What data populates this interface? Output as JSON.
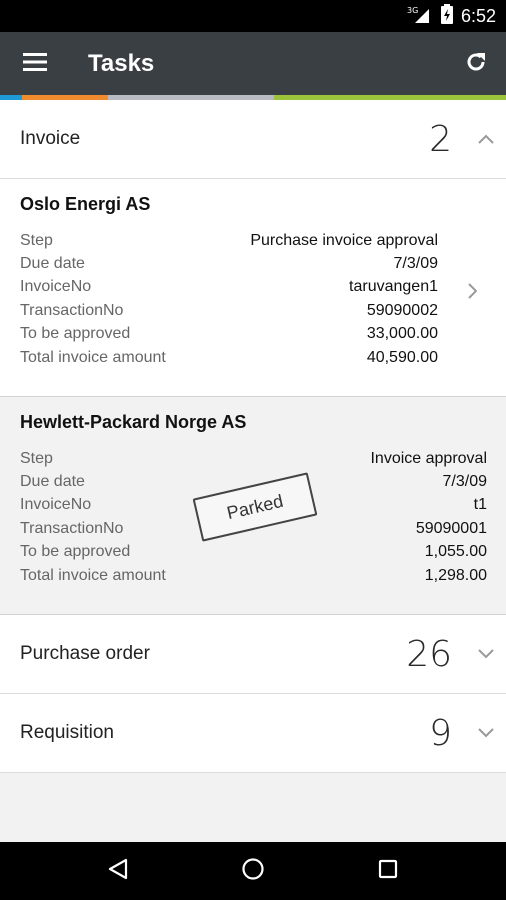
{
  "status_bar": {
    "network": "3G",
    "time": "6:52"
  },
  "app_bar": {
    "title": "Tasks",
    "menu_icon": "hamburger-menu-icon",
    "refresh_icon": "refresh-icon"
  },
  "colors": {
    "app_bar": "#3a3f44",
    "accent_blue": "#1e9ad6",
    "accent_orange": "#f08c2d",
    "accent_gray": "#b8bcc2",
    "accent_green": "#9cc43a"
  },
  "sections": {
    "invoice": {
      "label": "Invoice",
      "count": "2",
      "expanded": true,
      "tasks": [
        {
          "company": "Oslo Energi AS",
          "rows": [
            {
              "key": "Step",
              "value": "Purchase invoice approval"
            },
            {
              "key": "Due date",
              "value": "7/3/09"
            },
            {
              "key": "InvoiceNo",
              "value": "taruvangen1"
            },
            {
              "key": "TransactionNo",
              "value": "59090002"
            },
            {
              "key": "To be approved",
              "value": "33,000.00"
            },
            {
              "key": "Total invoice amount",
              "value": "40,590.00"
            }
          ]
        },
        {
          "company": "Hewlett-Packard Norge AS",
          "stamp": "Parked",
          "rows": [
            {
              "key": "Step",
              "value": "Invoice approval"
            },
            {
              "key": "Due date",
              "value": "7/3/09"
            },
            {
              "key": "InvoiceNo",
              "value": "t1"
            },
            {
              "key": "TransactionNo",
              "value": "59090001"
            },
            {
              "key": "To be approved",
              "value": "1,055.00"
            },
            {
              "key": "Total invoice amount",
              "value": "1,298.00"
            }
          ]
        }
      ]
    },
    "purchase_order": {
      "label": "Purchase order",
      "count": "26",
      "expanded": false
    },
    "requisition": {
      "label": "Requisition",
      "count": "9",
      "expanded": false
    }
  },
  "nav_bar": {
    "back_icon": "back-icon",
    "home_icon": "home-icon",
    "recents_icon": "recents-icon"
  }
}
